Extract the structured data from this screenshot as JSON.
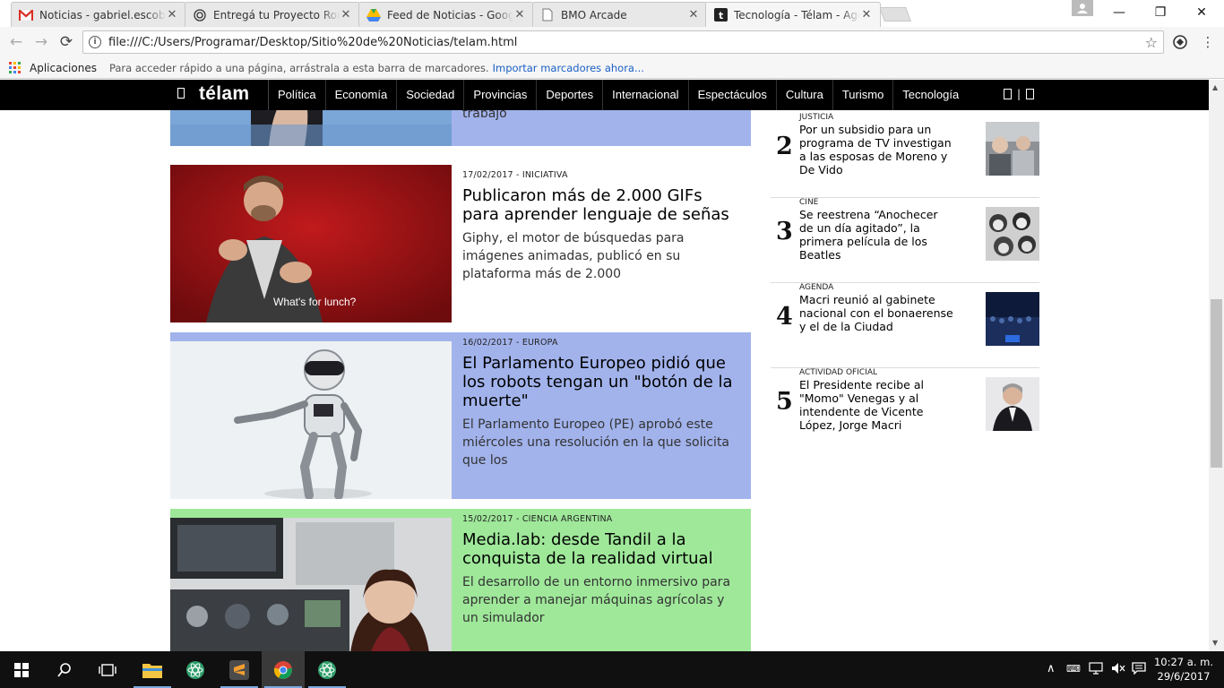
{
  "browser": {
    "tabs": [
      {
        "title": "Noticias - gabriel.escoba",
        "favicon": "gmail-icon"
      },
      {
        "title": "Entregá tu Proyecto Rom",
        "favicon": "radar-icon"
      },
      {
        "title": "Feed de Noticias - Googl",
        "favicon": "drive-icon"
      },
      {
        "title": "BMO Arcade",
        "favicon": "page-icon"
      },
      {
        "title": "Tecnología - Télam - Age",
        "favicon": "telam-icon"
      }
    ],
    "active_tab": 4,
    "url": "file:///C:/Users/Programar/Desktop/Sitio%20de%20Noticias/telam.html",
    "bookmarks": {
      "apps_label": "Aplicaciones",
      "hint": "Para acceder rápido a una página, arrástrala a esta barra de marcadores.",
      "import_link": "Importar marcadores ahora..."
    }
  },
  "site": {
    "logo": "télam",
    "categories": [
      "Política",
      "Economía",
      "Sociedad",
      "Provincias",
      "Deportes",
      "Internacional",
      "Espectáculos",
      "Cultura",
      "Turismo",
      "Tecnología"
    ]
  },
  "articles": [
    {
      "partial_text": "trabajo",
      "bg": "#a2b3ec"
    },
    {
      "meta": "17/02/2017 - INICIATIVA",
      "title": "Publicaron más de 2.000 GIFs para aprender lenguaje de señas",
      "summary": "Giphy, el motor de búsquedas para imágenes animadas, publicó en su plataforma más de 2.000",
      "caption": "What's for lunch?",
      "bg": "#ffffff"
    },
    {
      "meta": "16/02/2017 - EUROPA",
      "title": "El Parlamento Europeo pidió que los robots tengan un \"botón de la muerte\"",
      "summary": "El Parlamento Europeo (PE) aprobó este miércoles una resolución en la que solicita que los",
      "bg": "#a2b3ec"
    },
    {
      "meta": "15/02/2017 - CIENCIA ARGENTINA",
      "title": "Media.lab: desde Tandil a la conquista de la realidad virtual",
      "summary": "El desarrollo de un entorno inmersivo para aprender a manejar máquinas agrícolas y un simulador",
      "bg": "#9fe89a"
    }
  ],
  "ranking": [
    {
      "num": "2",
      "section": "JUSTICIA",
      "title": "Por un subsidio para un programa de TV investigan a las esposas de Moreno y De Vido"
    },
    {
      "num": "3",
      "section": "CINE",
      "title": "Se reestrena “Anochecer de un día agitado”, la primera película de los Beatles"
    },
    {
      "num": "4",
      "section": "AGENDA",
      "title": "Macri reunió al gabinete nacional con el bonaerense y el de la Ciudad"
    },
    {
      "num": "5",
      "section": "ACTIVIDAD OFICIAL",
      "title": "El Presidente recibe al \"Momo\" Venegas y al intendente de Vicente López, Jorge Macri"
    }
  ],
  "taskbar": {
    "time": "10:27 a. m.",
    "date": "29/6/2017"
  }
}
